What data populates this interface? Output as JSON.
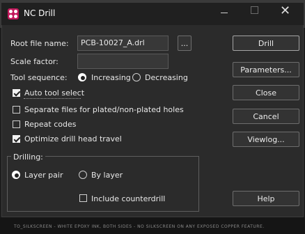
{
  "dialog": {
    "title": "NC Drill"
  },
  "form": {
    "root_file_label": "Root file name:",
    "root_file_value": "PCB-10027_A.drl",
    "browse_label": "...",
    "scale_factor_label": "Scale factor:",
    "scale_factor_value": "",
    "tool_sequence_label": "Tool sequence:",
    "tool_sequence_options": [
      "Increasing",
      "Decreasing"
    ],
    "tool_sequence_selected": "Increasing",
    "auto_tool_select_label": "Auto tool select",
    "auto_tool_select_checked": true,
    "separate_files_label": "Separate files for plated/non-plated holes",
    "separate_files_checked": false,
    "repeat_codes_label": "Repeat codes",
    "repeat_codes_checked": false,
    "optimize_label": "Optimize drill head travel",
    "optimize_checked": true
  },
  "drilling": {
    "group_label": "Drilling:",
    "options": [
      "Layer pair",
      "By layer"
    ],
    "selected": "Layer pair",
    "include_counterdrill_label": "Include counterdrill",
    "include_counterdrill_checked": false
  },
  "buttons": {
    "drill": "Drill",
    "parameters": "Parameters...",
    "close": "Close",
    "cancel": "Cancel",
    "viewlog": "Viewlog...",
    "help": "Help"
  },
  "background": {
    "status_text": "TO_SILKSCREEN - WHITE EPOXY INK, BOTH SIDES - NO SILKSCREEN ON ANY EXPOSED COPPER FEATURE."
  },
  "colors": {
    "dialog_bg": "#2b2b2b",
    "titlebar_bg": "#202020",
    "app_icon": "#c2185b"
  }
}
